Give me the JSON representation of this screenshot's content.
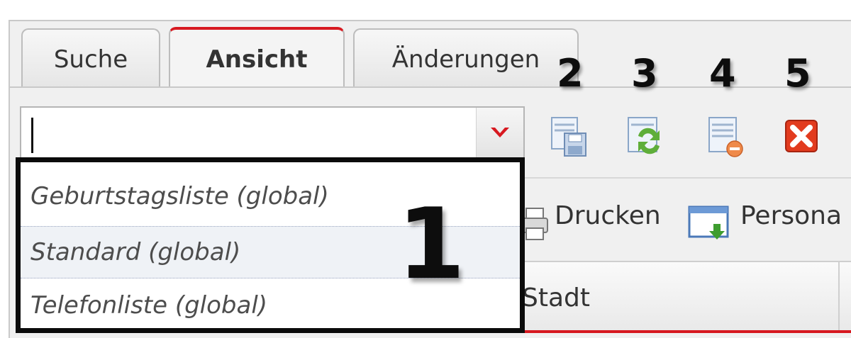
{
  "tabs": [
    {
      "label": "Suche",
      "active": false
    },
    {
      "label": "Ansicht",
      "active": true
    },
    {
      "label": "Änderungen",
      "active": false
    }
  ],
  "view_combo": {
    "value": ""
  },
  "dropdown": {
    "options": [
      "Geburtstagsliste (global)",
      "Standard (global)",
      "Telefonliste (global)"
    ],
    "highlighted_index": 1
  },
  "annotations": {
    "n1": "1",
    "n2": "2",
    "n3": "3",
    "n4": "4",
    "n5": "5"
  },
  "toolbar": {
    "icons": [
      "save-view-icon",
      "refresh-view-icon",
      "remove-view-icon",
      "close-red-icon"
    ]
  },
  "toolbar2": {
    "print_label": "Drucken",
    "personal_label": "Persona"
  },
  "grid": {
    "column_label": "Stadt"
  },
  "colors": {
    "accent": "#d71920",
    "annotation_box": "#0b0b0b"
  }
}
